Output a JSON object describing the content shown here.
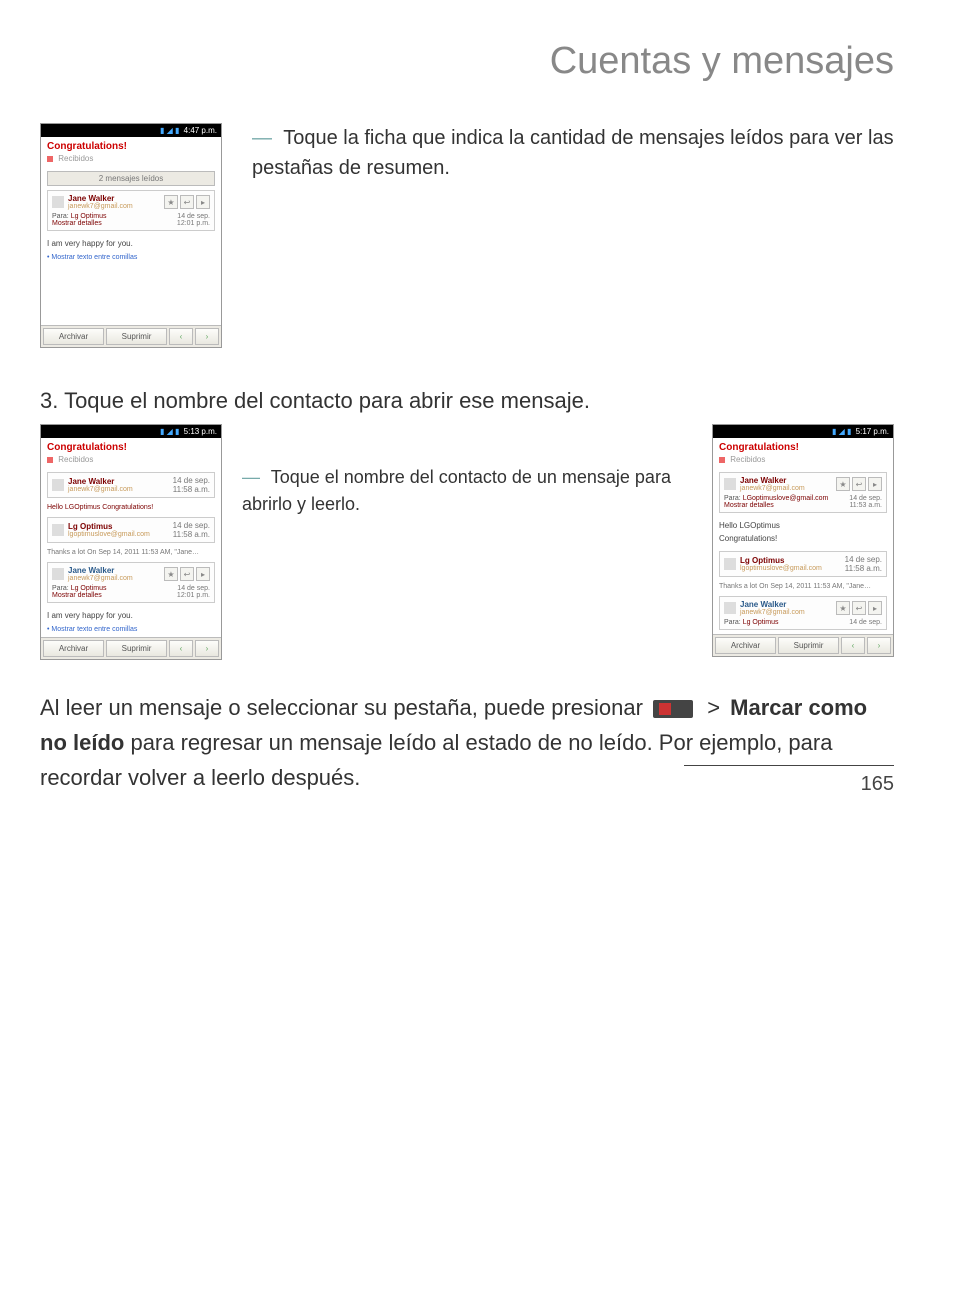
{
  "title": "Cuentas y mensajes",
  "page_number": "165",
  "section1": {
    "caption": "Toque la ficha que indica la cantidad de mensajes leídos para ver las pestañas de resumen.",
    "phone": {
      "time": "4:47 p.m.",
      "subject": "Congratulations!",
      "inbox": "Recibidos",
      "tab_label": "2 mensajes leídos",
      "sender": "Jane Walker",
      "sender_email": "janewk7@gmail.com",
      "para_label": "Para:",
      "para_value": "Lg Optimus",
      "date": "14 de sep.",
      "time2": "12:01 p.m.",
      "details": "Mostrar detalles",
      "body": "I am very happy for you.",
      "link": "• Mostrar texto entre comillas",
      "archive": "Archivar",
      "delete": "Suprimir"
    }
  },
  "step3": {
    "title": "3. Toque el nombre del contacto para abrir ese mensaje.",
    "caption": "Toque el nombre del contacto de un mensaje para abrirlo y leerlo.",
    "phoneL": {
      "time": "5:13 p.m.",
      "subject": "Congratulations!",
      "inbox": "Recibidos",
      "sender1": "Jane Walker",
      "email1": "janewk7@gmail.com",
      "date1": "14 de sep.",
      "t1": "11:58 a.m.",
      "snippet1": "Hello LGOptimus Congratulations!",
      "sender2": "Lg Optimus",
      "email2": "lgoptimuslove@gmail.com",
      "date2": "14 de sep.",
      "t2": "11:58 a.m.",
      "snippet2": "Thanks a lot On Sep 14, 2011 11:53 AM, \"Jane…",
      "sender3": "Jane Walker",
      "email3": "janewk7@gmail.com",
      "para_label": "Para:",
      "para_value": "Lg Optimus",
      "date3": "14 de sep.",
      "t3": "12:01 p.m.",
      "details": "Mostrar detalles",
      "body": "I am very happy for you.",
      "link": "• Mostrar texto entre comillas",
      "archive": "Archivar",
      "delete": "Suprimir"
    },
    "phoneR": {
      "time": "5:17 p.m.",
      "subject": "Congratulations!",
      "inbox": "Recibidos",
      "sender1": "Jane Walker",
      "email1": "janewk7@gmail.com",
      "para_label": "Para:",
      "para_value": "LGoptimuslove@gmail.com",
      "date1": "14 de sep.",
      "t1": "11:53 a.m.",
      "details": "Mostrar detalles",
      "body1a": "Hello LGOptimus",
      "body1b": "Congratulations!",
      "sender2": "Lg Optimus",
      "email2": "lgoptimuslove@gmail.com",
      "date2": "14 de sep.",
      "t2": "11:58 a.m.",
      "snippet2": "Thanks a lot On Sep 14, 2011 11:53 AM, \"Jane…",
      "sender3": "Jane Walker",
      "email3": "janewk7@gmail.com",
      "para_label2": "Para:",
      "para_value2": "Lg Optimus",
      "date3": "14 de sep.",
      "archive": "Archivar",
      "delete": "Suprimir"
    }
  },
  "paragraph": {
    "pre": "Al leer un mensaje o seleccionar su pestaña, puede presionar",
    "gt": ">",
    "bold": "Marcar como no leído",
    "post": " para regresar un mensaje leído al estado de no leído. Por ejemplo, para recordar volver a leerlo después."
  }
}
